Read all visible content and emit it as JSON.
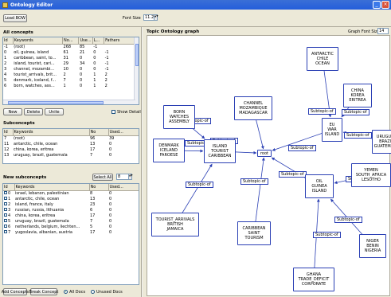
{
  "window": {
    "title": "Ontology Editor"
  },
  "toolbar": {
    "load_label": "Load BOW",
    "font_size_label": "Font Size",
    "font_size_value": "11.25"
  },
  "all_concepts": {
    "title": "All concepts",
    "columns": [
      "Id",
      "Keywords",
      "No...",
      "Use...",
      "L...",
      "Fathers"
    ],
    "rows": [
      [
        "-1",
        "(root)",
        "268",
        "85",
        "-1",
        ""
      ],
      [
        "0",
        "oil, guinea, island",
        "61",
        "21",
        "0",
        "-1"
      ],
      [
        "1",
        "caribbean, saint, to...",
        "31",
        "0",
        "0",
        "-1"
      ],
      [
        "2",
        "island, tourist, cari...",
        "29",
        "34",
        "0",
        "-1"
      ],
      [
        "3",
        "channel, mozambi...",
        "10",
        "0",
        "0",
        "-1"
      ],
      [
        "4",
        "tourist_arrivals, brit...",
        "2",
        "0",
        "1",
        "2"
      ],
      [
        "5",
        "denmark, iceland, f...",
        "7",
        "0",
        "1",
        "2"
      ],
      [
        "6",
        "born, watches, ass...",
        "1",
        "0",
        "1",
        "2"
      ]
    ],
    "new_label": "New",
    "delete_label": "Delete",
    "unite_label": "Unite",
    "show_detail_label": "Show Detail"
  },
  "subconcepts": {
    "title": "Subconcepts",
    "columns": [
      "Id",
      "Keywords",
      "No",
      "Used..."
    ],
    "rows": [
      [
        "7",
        "(root)",
        "96",
        "39"
      ],
      [
        "11",
        "antarctic, chile, ocean",
        "13",
        "0"
      ],
      [
        "12",
        "china, korea, eritrea",
        "17",
        "0"
      ],
      [
        "13",
        "uruguay, brazil, guatemala",
        "7",
        "0"
      ]
    ]
  },
  "new_subconcepts": {
    "title": "New subconcepts",
    "select_all_label": "Select All",
    "count_value": "8",
    "columns": [
      "Id",
      "Keywords",
      "No",
      "Used..."
    ],
    "rows": [
      [
        "0",
        "israel, lebanon, palestinian",
        "8",
        "0"
      ],
      [
        "1",
        "antarctic, chile, ocean",
        "13",
        "0"
      ],
      [
        "2",
        "island, france, italy",
        "23",
        "0"
      ],
      [
        "3",
        "russian, russia, lithuania",
        "6",
        "0"
      ],
      [
        "4",
        "china, korea, eritrea",
        "17",
        "0"
      ],
      [
        "5",
        "uruguay, brazil, guatemala",
        "7",
        "0"
      ],
      [
        "6",
        "netherlands, belgium, liechten...",
        "5",
        "0"
      ],
      [
        "7",
        "yugoslavia, albanian, austria",
        "17",
        "0"
      ]
    ],
    "add_concepts_label": "Add Concepts",
    "break_concept_label": "Break Concept",
    "all_docs_label": "All Docs",
    "unused_docs_label": "Unused Docs"
  },
  "graph": {
    "title": "Topic Ontology graph",
    "font_size_label": "Graph Font Size",
    "font_size_value": "14",
    "edge_label": "Subtopic-of",
    "root_label": "root",
    "nodes": {
      "antarctic": [
        "ANTARCTIC",
        "CHILE",
        "OCEAN"
      ],
      "china": [
        "CHINA",
        "KOREA",
        "ERITREA"
      ],
      "channel": [
        "CHANNEL",
        "MOZAMBIQUE",
        "MADAGASCAR"
      ],
      "born": [
        "BORN",
        "WATCHES",
        "ASSEMBLY"
      ],
      "eu": [
        "EU",
        "WAR",
        "ISLAND"
      ],
      "uruguay": [
        "URUGUAY",
        "BRAZIL",
        "GUATEMALA"
      ],
      "denmark": [
        "DENMARK",
        "ICELAND",
        "FAROESE"
      ],
      "island": [
        "ISLAND",
        "TOURIST",
        "CARIBBEAN"
      ],
      "yemen": [
        "YEMEN",
        "SOUTH_AFRICA",
        "LESOTHO"
      ],
      "oil": [
        "OIL",
        "GUINEA",
        "ISLAND"
      ],
      "tourist": [
        "TOURIST_ARRIVALS",
        "BRITISH",
        "JAMAICA"
      ],
      "caribbean": [
        "CARIBBEAN",
        "SAINT",
        "TOURISM"
      ],
      "niger": [
        "NIGER",
        "BENIN",
        "NIGERIA"
      ],
      "ghana": [
        "GHANA",
        "TRADE_DEFICIT",
        "CORPORATE"
      ]
    }
  }
}
